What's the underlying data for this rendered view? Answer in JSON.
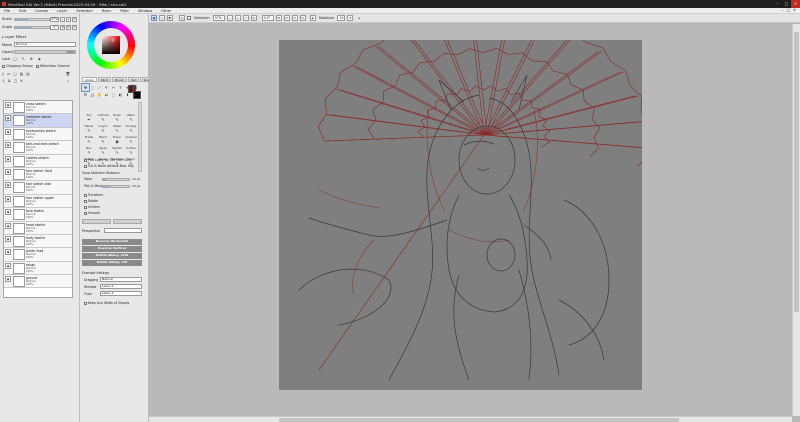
{
  "window": {
    "title": "PaintTool SAI Ver.2 (64bit) Preview.2023.04.09 - 99w / sha.sai2",
    "controls": [
      "–",
      "□",
      "✕"
    ]
  },
  "menu": [
    "File",
    "Edit",
    "Canvas",
    "Layer",
    "Selection",
    "Ruler",
    "Filter",
    "Window",
    "Other"
  ],
  "mdi_controls": [
    "–",
    "□",
    "✕"
  ],
  "toolbar": {
    "selection_label": "Selection",
    "zoom_value": "37%",
    "angle_value": "0.0°",
    "stabilizer_label": "Stabilizer",
    "stabilizer_value": "15"
  },
  "left_panel": {
    "scale_label": "Scale",
    "scale_value": "37%",
    "scale_fraction": 0.37,
    "angle_label": "Angle",
    "angle_value": "0°",
    "angle_fraction": 0.5,
    "layer_effect_label": "Layer Effect",
    "mode_label": "Mode",
    "mode_value": "Normal",
    "opacity_label": "Opacity",
    "opacity_value": "100%",
    "lock_label": "Lock",
    "clipping_label": "Clipping Group",
    "selection_source_label": "Selection Source",
    "layers": [
      {
        "name": "cross sketch",
        "mode": "Normal",
        "opacity": "100%",
        "selected": false
      },
      {
        "name": "umbrella sketch",
        "mode": "Normal",
        "opacity": "100%",
        "selected": true
      },
      {
        "name": "accessories sketch",
        "mode": "Normal",
        "opacity": "100%",
        "selected": false
      },
      {
        "name": "tails and ears sketch",
        "mode": "Normal",
        "opacity": "100%",
        "selected": false
      },
      {
        "name": "clothes sketch",
        "mode": "Normal",
        "opacity": "100%",
        "selected": false
      },
      {
        "name": "hair sketch front",
        "mode": "Normal",
        "opacity": "100%",
        "selected": false
      },
      {
        "name": "hair sketch side",
        "mode": "Normal",
        "opacity": "100%",
        "selected": false
      },
      {
        "name": "hair sketch upper",
        "mode": "Normal",
        "opacity": "100%",
        "selected": false
      },
      {
        "name": "face sketch",
        "mode": "Normal",
        "opacity": "100%",
        "selected": false
      },
      {
        "name": "head sketch",
        "mode": "Normal",
        "opacity": "100%",
        "selected": false
      },
      {
        "name": "body sketch",
        "mode": "Normal",
        "opacity": "100%",
        "selected": false
      },
      {
        "name": "guide lines",
        "mode": "Normal",
        "opacity": "100%",
        "selected": false
      },
      {
        "name": "rough",
        "mode": "Normal",
        "opacity": "100%",
        "selected": false
      },
      {
        "name": "ground",
        "mode": "Normal",
        "opacity": "100%",
        "selected": false
      }
    ]
  },
  "tool_panel": {
    "tabs": [
      "Airspr",
      "Paint",
      "Brush",
      "Pen 2",
      "Shapes"
    ],
    "active_tab": 0,
    "tools": [
      "✥",
      "⬚",
      "⟋",
      "✎",
      "✂",
      "T",
      "⌖",
      "⬛",
      "☰",
      "◳",
      "✋",
      "⤾",
      "⬚",
      "◐",
      "⬇",
      "◆"
    ],
    "brushes": [
      {
        "name": "Pen",
        "icon": "✒"
      },
      {
        "name": "AirBrush",
        "icon": "✎"
      },
      {
        "name": "Brush",
        "icon": "✎"
      },
      {
        "name": "Water",
        "icon": "✎"
      },
      {
        "name": "Marker",
        "icon": "✎"
      },
      {
        "name": "Crayon",
        "icon": "✎"
      },
      {
        "name": "Pastel",
        "icon": "✎"
      },
      {
        "name": "Smudge",
        "icon": "✎"
      },
      {
        "name": "Bristle",
        "icon": "✎"
      },
      {
        "name": "Blend",
        "icon": "✎"
      },
      {
        "name": "Eraser",
        "icon": "◼"
      },
      {
        "name": "Gradient",
        "icon": "✎"
      },
      {
        "name": "Blur",
        "icon": "✎"
      },
      {
        "name": "Spray",
        "icon": "✎"
      },
      {
        "name": "Sparkle",
        "icon": "✎"
      },
      {
        "name": "Outline",
        "icon": "✎"
      },
      {
        "name": "Sketch",
        "icon": "✎"
      },
      {
        "name": "Binder",
        "icon": "✎"
      },
      {
        "name": "Mechanic",
        "icon": "✎"
      },
      {
        "name": "Pencil",
        "icon": "✎"
      }
    ],
    "pick_layer_label": "Pick Layer by Ctrl+Alt+Click",
    "cut_move_label": "Cut & Move without Mod. Key",
    "snap_label": "Snap Selection Distance",
    "move_label": "Move",
    "move_value": "10 px",
    "move_fraction": 0.1,
    "pick_move_label": "Pick & Move",
    "pick_move_value": "10 px",
    "pick_move_fraction": 0.3,
    "transform_label": "Transform",
    "rotate_label": "Rotate",
    "uniform_label": "Uniform",
    "smooth_label": "Smooth",
    "perspective_label": "Perspective",
    "perspective_value": "",
    "perspective_fraction": 0.0,
    "action_buttons": [
      "Reverse Horizontal",
      "Reverse Vertical",
      "Rotate 90deg. CCW",
      "Rotate 90deg. CW"
    ],
    "example_settings_label": "Example Settings",
    "dragging_label": "Dragging",
    "dragging_value": "Natural",
    "window_label": "Window",
    "window_value": "Lasso 2",
    "fluid_label": "Fluid",
    "fluid_value": "Lasso 3",
    "keep_width_label": "Keep Line Width of Shapes"
  },
  "colors": {
    "foreground": "#6b0f12",
    "background": "#000000",
    "canvas_bg": "#7f7f7f",
    "sketch_red": "#8a2a2a",
    "sketch_dark": "#2f2f2f",
    "selected_layer": "#cfd6f3"
  }
}
